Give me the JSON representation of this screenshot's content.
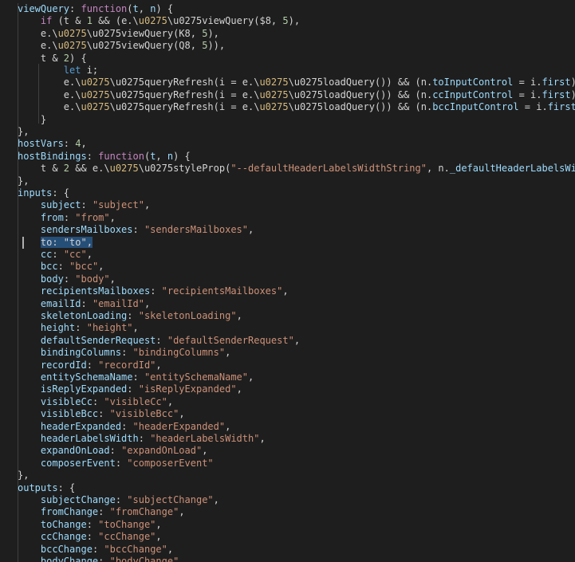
{
  "code_lines": [
    [
      {
        "t": "viewQuery",
        "c": "k"
      },
      {
        "t": ": ",
        "c": "p"
      },
      {
        "t": "function",
        "c": "fn"
      },
      {
        "t": "(",
        "c": "p"
      },
      {
        "t": "t",
        "c": "k"
      },
      {
        "t": ", ",
        "c": "p"
      },
      {
        "t": "n",
        "c": "k"
      },
      {
        "t": ") {",
        "c": "p"
      }
    ],
    [
      {
        "t": "    ",
        "c": "p"
      },
      {
        "t": "if",
        "c": "fn"
      },
      {
        "t": " (t & ",
        "c": "p"
      },
      {
        "t": "1",
        "c": "n"
      },
      {
        "t": " && (e.\\",
        "c": "p"
      },
      {
        "t": "u0275",
        "c": "esc"
      },
      {
        "t": "\\u0275viewQuery($8, ",
        "c": "p"
      },
      {
        "t": "5",
        "c": "n"
      },
      {
        "t": "),",
        "c": "p"
      }
    ],
    [
      {
        "t": "    e.\\",
        "c": "p"
      },
      {
        "t": "u0275",
        "c": "esc"
      },
      {
        "t": "\\u0275viewQuery(K8, ",
        "c": "p"
      },
      {
        "t": "5",
        "c": "n"
      },
      {
        "t": "),",
        "c": "p"
      }
    ],
    [
      {
        "t": "    e.\\",
        "c": "p"
      },
      {
        "t": "u0275",
        "c": "esc"
      },
      {
        "t": "\\u0275viewQuery(Q8, ",
        "c": "p"
      },
      {
        "t": "5",
        "c": "n"
      },
      {
        "t": ")),",
        "c": "p"
      }
    ],
    [
      {
        "t": "    t & ",
        "c": "p"
      },
      {
        "t": "2",
        "c": "n"
      },
      {
        "t": ") {",
        "c": "p"
      }
    ],
    [
      {
        "t": "        ",
        "c": "p"
      },
      {
        "t": "let",
        "c": "kw"
      },
      {
        "t": " i;",
        "c": "p"
      }
    ],
    [
      {
        "t": "        e.\\",
        "c": "p"
      },
      {
        "t": "u0275",
        "c": "esc"
      },
      {
        "t": "\\u0275queryRefresh(i = e.\\",
        "c": "p"
      },
      {
        "t": "u0275",
        "c": "esc"
      },
      {
        "t": "\\u0275loadQuery()) && (n.",
        "c": "p"
      },
      {
        "t": "toInputControl",
        "c": "k"
      },
      {
        "t": " = i.",
        "c": "p"
      },
      {
        "t": "first",
        "c": "k"
      },
      {
        "t": "),",
        "c": "p"
      }
    ],
    [
      {
        "t": "        e.\\",
        "c": "p"
      },
      {
        "t": "u0275",
        "c": "esc"
      },
      {
        "t": "\\u0275queryRefresh(i = e.\\",
        "c": "p"
      },
      {
        "t": "u0275",
        "c": "esc"
      },
      {
        "t": "\\u0275loadQuery()) && (n.",
        "c": "p"
      },
      {
        "t": "ccInputControl",
        "c": "k"
      },
      {
        "t": " = i.",
        "c": "p"
      },
      {
        "t": "first",
        "c": "k"
      },
      {
        "t": "),",
        "c": "p"
      }
    ],
    [
      {
        "t": "        e.\\",
        "c": "p"
      },
      {
        "t": "u0275",
        "c": "esc"
      },
      {
        "t": "\\u0275queryRefresh(i = e.\\",
        "c": "p"
      },
      {
        "t": "u0275",
        "c": "esc"
      },
      {
        "t": "\\u0275loadQuery()) && (n.",
        "c": "p"
      },
      {
        "t": "bccInputControl",
        "c": "k"
      },
      {
        "t": " = i.",
        "c": "p"
      },
      {
        "t": "first",
        "c": "k"
      },
      {
        "t": ")",
        "c": "p"
      }
    ],
    [
      {
        "t": "    }",
        "c": "p"
      }
    ],
    [
      {
        "t": "},",
        "c": "p"
      }
    ],
    [
      {
        "t": "hostVars",
        "c": "k"
      },
      {
        "t": ": ",
        "c": "p"
      },
      {
        "t": "4",
        "c": "n"
      },
      {
        "t": ",",
        "c": "p"
      }
    ],
    [
      {
        "t": "hostBindings",
        "c": "k"
      },
      {
        "t": ": ",
        "c": "p"
      },
      {
        "t": "function",
        "c": "fn"
      },
      {
        "t": "(",
        "c": "p"
      },
      {
        "t": "t",
        "c": "k"
      },
      {
        "t": ", ",
        "c": "p"
      },
      {
        "t": "n",
        "c": "k"
      },
      {
        "t": ") {",
        "c": "p"
      }
    ],
    [
      {
        "t": "    t & ",
        "c": "p"
      },
      {
        "t": "2",
        "c": "n"
      },
      {
        "t": " && e.\\",
        "c": "p"
      },
      {
        "t": "u0275",
        "c": "esc"
      },
      {
        "t": "\\u0275styleProp(",
        "c": "p"
      },
      {
        "t": "\"--defaultHeaderLabelsWidthString\"",
        "c": "s"
      },
      {
        "t": ", n.",
        "c": "p"
      },
      {
        "t": "_defaultHeaderLabelsWidthString",
        "c": "k"
      }
    ],
    [
      {
        "t": "},",
        "c": "p"
      }
    ],
    [
      {
        "t": "inputs",
        "c": "k"
      },
      {
        "t": ": {",
        "c": "p"
      }
    ],
    [
      {
        "t": "    ",
        "c": "p"
      },
      {
        "t": "subject",
        "c": "k"
      },
      {
        "t": ": ",
        "c": "p"
      },
      {
        "t": "\"subject\"",
        "c": "s"
      },
      {
        "t": ",",
        "c": "p"
      }
    ],
    [
      {
        "t": "    ",
        "c": "p"
      },
      {
        "t": "from",
        "c": "k"
      },
      {
        "t": ": ",
        "c": "p"
      },
      {
        "t": "\"from\"",
        "c": "s"
      },
      {
        "t": ",",
        "c": "p"
      }
    ],
    [
      {
        "t": "    ",
        "c": "p"
      },
      {
        "t": "sendersMailboxes",
        "c": "k"
      },
      {
        "t": ": ",
        "c": "p"
      },
      {
        "t": "\"sendersMailboxes\"",
        "c": "s"
      },
      {
        "t": ",",
        "c": "p"
      }
    ],
    [
      {
        "t": "    ",
        "c": "p"
      },
      {
        "t": "to: \"to\",",
        "c": "sel"
      }
    ],
    [
      {
        "t": "    ",
        "c": "p"
      },
      {
        "t": "cc",
        "c": "k"
      },
      {
        "t": ": ",
        "c": "p"
      },
      {
        "t": "\"cc\"",
        "c": "s"
      },
      {
        "t": ",",
        "c": "p"
      }
    ],
    [
      {
        "t": "    ",
        "c": "p"
      },
      {
        "t": "bcc",
        "c": "k"
      },
      {
        "t": ": ",
        "c": "p"
      },
      {
        "t": "\"bcc\"",
        "c": "s"
      },
      {
        "t": ",",
        "c": "p"
      }
    ],
    [
      {
        "t": "    ",
        "c": "p"
      },
      {
        "t": "body",
        "c": "k"
      },
      {
        "t": ": ",
        "c": "p"
      },
      {
        "t": "\"body\"",
        "c": "s"
      },
      {
        "t": ",",
        "c": "p"
      }
    ],
    [
      {
        "t": "    ",
        "c": "p"
      },
      {
        "t": "recipientsMailboxes",
        "c": "k"
      },
      {
        "t": ": ",
        "c": "p"
      },
      {
        "t": "\"recipientsMailboxes\"",
        "c": "s"
      },
      {
        "t": ",",
        "c": "p"
      }
    ],
    [
      {
        "t": "    ",
        "c": "p"
      },
      {
        "t": "emailId",
        "c": "k"
      },
      {
        "t": ": ",
        "c": "p"
      },
      {
        "t": "\"emailId\"",
        "c": "s"
      },
      {
        "t": ",",
        "c": "p"
      }
    ],
    [
      {
        "t": "    ",
        "c": "p"
      },
      {
        "t": "skeletonLoading",
        "c": "k"
      },
      {
        "t": ": ",
        "c": "p"
      },
      {
        "t": "\"skeletonLoading\"",
        "c": "s"
      },
      {
        "t": ",",
        "c": "p"
      }
    ],
    [
      {
        "t": "    ",
        "c": "p"
      },
      {
        "t": "height",
        "c": "k"
      },
      {
        "t": ": ",
        "c": "p"
      },
      {
        "t": "\"height\"",
        "c": "s"
      },
      {
        "t": ",",
        "c": "p"
      }
    ],
    [
      {
        "t": "    ",
        "c": "p"
      },
      {
        "t": "defaultSenderRequest",
        "c": "k"
      },
      {
        "t": ": ",
        "c": "p"
      },
      {
        "t": "\"defaultSenderRequest\"",
        "c": "s"
      },
      {
        "t": ",",
        "c": "p"
      }
    ],
    [
      {
        "t": "    ",
        "c": "p"
      },
      {
        "t": "bindingColumns",
        "c": "k"
      },
      {
        "t": ": ",
        "c": "p"
      },
      {
        "t": "\"bindingColumns\"",
        "c": "s"
      },
      {
        "t": ",",
        "c": "p"
      }
    ],
    [
      {
        "t": "    ",
        "c": "p"
      },
      {
        "t": "recordId",
        "c": "k"
      },
      {
        "t": ": ",
        "c": "p"
      },
      {
        "t": "\"recordId\"",
        "c": "s"
      },
      {
        "t": ",",
        "c": "p"
      }
    ],
    [
      {
        "t": "    ",
        "c": "p"
      },
      {
        "t": "entitySchemaName",
        "c": "k"
      },
      {
        "t": ": ",
        "c": "p"
      },
      {
        "t": "\"entitySchemaName\"",
        "c": "s"
      },
      {
        "t": ",",
        "c": "p"
      }
    ],
    [
      {
        "t": "    ",
        "c": "p"
      },
      {
        "t": "isReplyExpanded",
        "c": "k"
      },
      {
        "t": ": ",
        "c": "p"
      },
      {
        "t": "\"isReplyExpanded\"",
        "c": "s"
      },
      {
        "t": ",",
        "c": "p"
      }
    ],
    [
      {
        "t": "    ",
        "c": "p"
      },
      {
        "t": "visibleCc",
        "c": "k"
      },
      {
        "t": ": ",
        "c": "p"
      },
      {
        "t": "\"visibleCc\"",
        "c": "s"
      },
      {
        "t": ",",
        "c": "p"
      }
    ],
    [
      {
        "t": "    ",
        "c": "p"
      },
      {
        "t": "visibleBcc",
        "c": "k"
      },
      {
        "t": ": ",
        "c": "p"
      },
      {
        "t": "\"visibleBcc\"",
        "c": "s"
      },
      {
        "t": ",",
        "c": "p"
      }
    ],
    [
      {
        "t": "    ",
        "c": "p"
      },
      {
        "t": "headerExpanded",
        "c": "k"
      },
      {
        "t": ": ",
        "c": "p"
      },
      {
        "t": "\"headerExpanded\"",
        "c": "s"
      },
      {
        "t": ",",
        "c": "p"
      }
    ],
    [
      {
        "t": "    ",
        "c": "p"
      },
      {
        "t": "headerLabelsWidth",
        "c": "k"
      },
      {
        "t": ": ",
        "c": "p"
      },
      {
        "t": "\"headerLabelsWidth\"",
        "c": "s"
      },
      {
        "t": ",",
        "c": "p"
      }
    ],
    [
      {
        "t": "    ",
        "c": "p"
      },
      {
        "t": "expandOnLoad",
        "c": "k"
      },
      {
        "t": ": ",
        "c": "p"
      },
      {
        "t": "\"expandOnLoad\"",
        "c": "s"
      },
      {
        "t": ",",
        "c": "p"
      }
    ],
    [
      {
        "t": "    ",
        "c": "p"
      },
      {
        "t": "composerEvent",
        "c": "k"
      },
      {
        "t": ": ",
        "c": "p"
      },
      {
        "t": "\"composerEvent\"",
        "c": "s"
      }
    ],
    [
      {
        "t": "},",
        "c": "p"
      }
    ],
    [
      {
        "t": "outputs",
        "c": "k"
      },
      {
        "t": ": {",
        "c": "p"
      }
    ],
    [
      {
        "t": "    ",
        "c": "p"
      },
      {
        "t": "subjectChange",
        "c": "k"
      },
      {
        "t": ": ",
        "c": "p"
      },
      {
        "t": "\"subjectChange\"",
        "c": "s"
      },
      {
        "t": ",",
        "c": "p"
      }
    ],
    [
      {
        "t": "    ",
        "c": "p"
      },
      {
        "t": "fromChange",
        "c": "k"
      },
      {
        "t": ": ",
        "c": "p"
      },
      {
        "t": "\"fromChange\"",
        "c": "s"
      },
      {
        "t": ",",
        "c": "p"
      }
    ],
    [
      {
        "t": "    ",
        "c": "p"
      },
      {
        "t": "toChange",
        "c": "k"
      },
      {
        "t": ": ",
        "c": "p"
      },
      {
        "t": "\"toChange\"",
        "c": "s"
      },
      {
        "t": ",",
        "c": "p"
      }
    ],
    [
      {
        "t": "    ",
        "c": "p"
      },
      {
        "t": "ccChange",
        "c": "k"
      },
      {
        "t": ": ",
        "c": "p"
      },
      {
        "t": "\"ccChange\"",
        "c": "s"
      },
      {
        "t": ",",
        "c": "p"
      }
    ],
    [
      {
        "t": "    ",
        "c": "p"
      },
      {
        "t": "bccChange",
        "c": "k"
      },
      {
        "t": ": ",
        "c": "p"
      },
      {
        "t": "\"bccChange\"",
        "c": "s"
      },
      {
        "t": ",",
        "c": "p"
      }
    ],
    [
      {
        "t": "    ",
        "c": "p"
      },
      {
        "t": "bodyChange",
        "c": "k"
      },
      {
        "t": ": ",
        "c": "p"
      },
      {
        "t": "\"bodyChange\"",
        "c": "s"
      }
    ]
  ]
}
